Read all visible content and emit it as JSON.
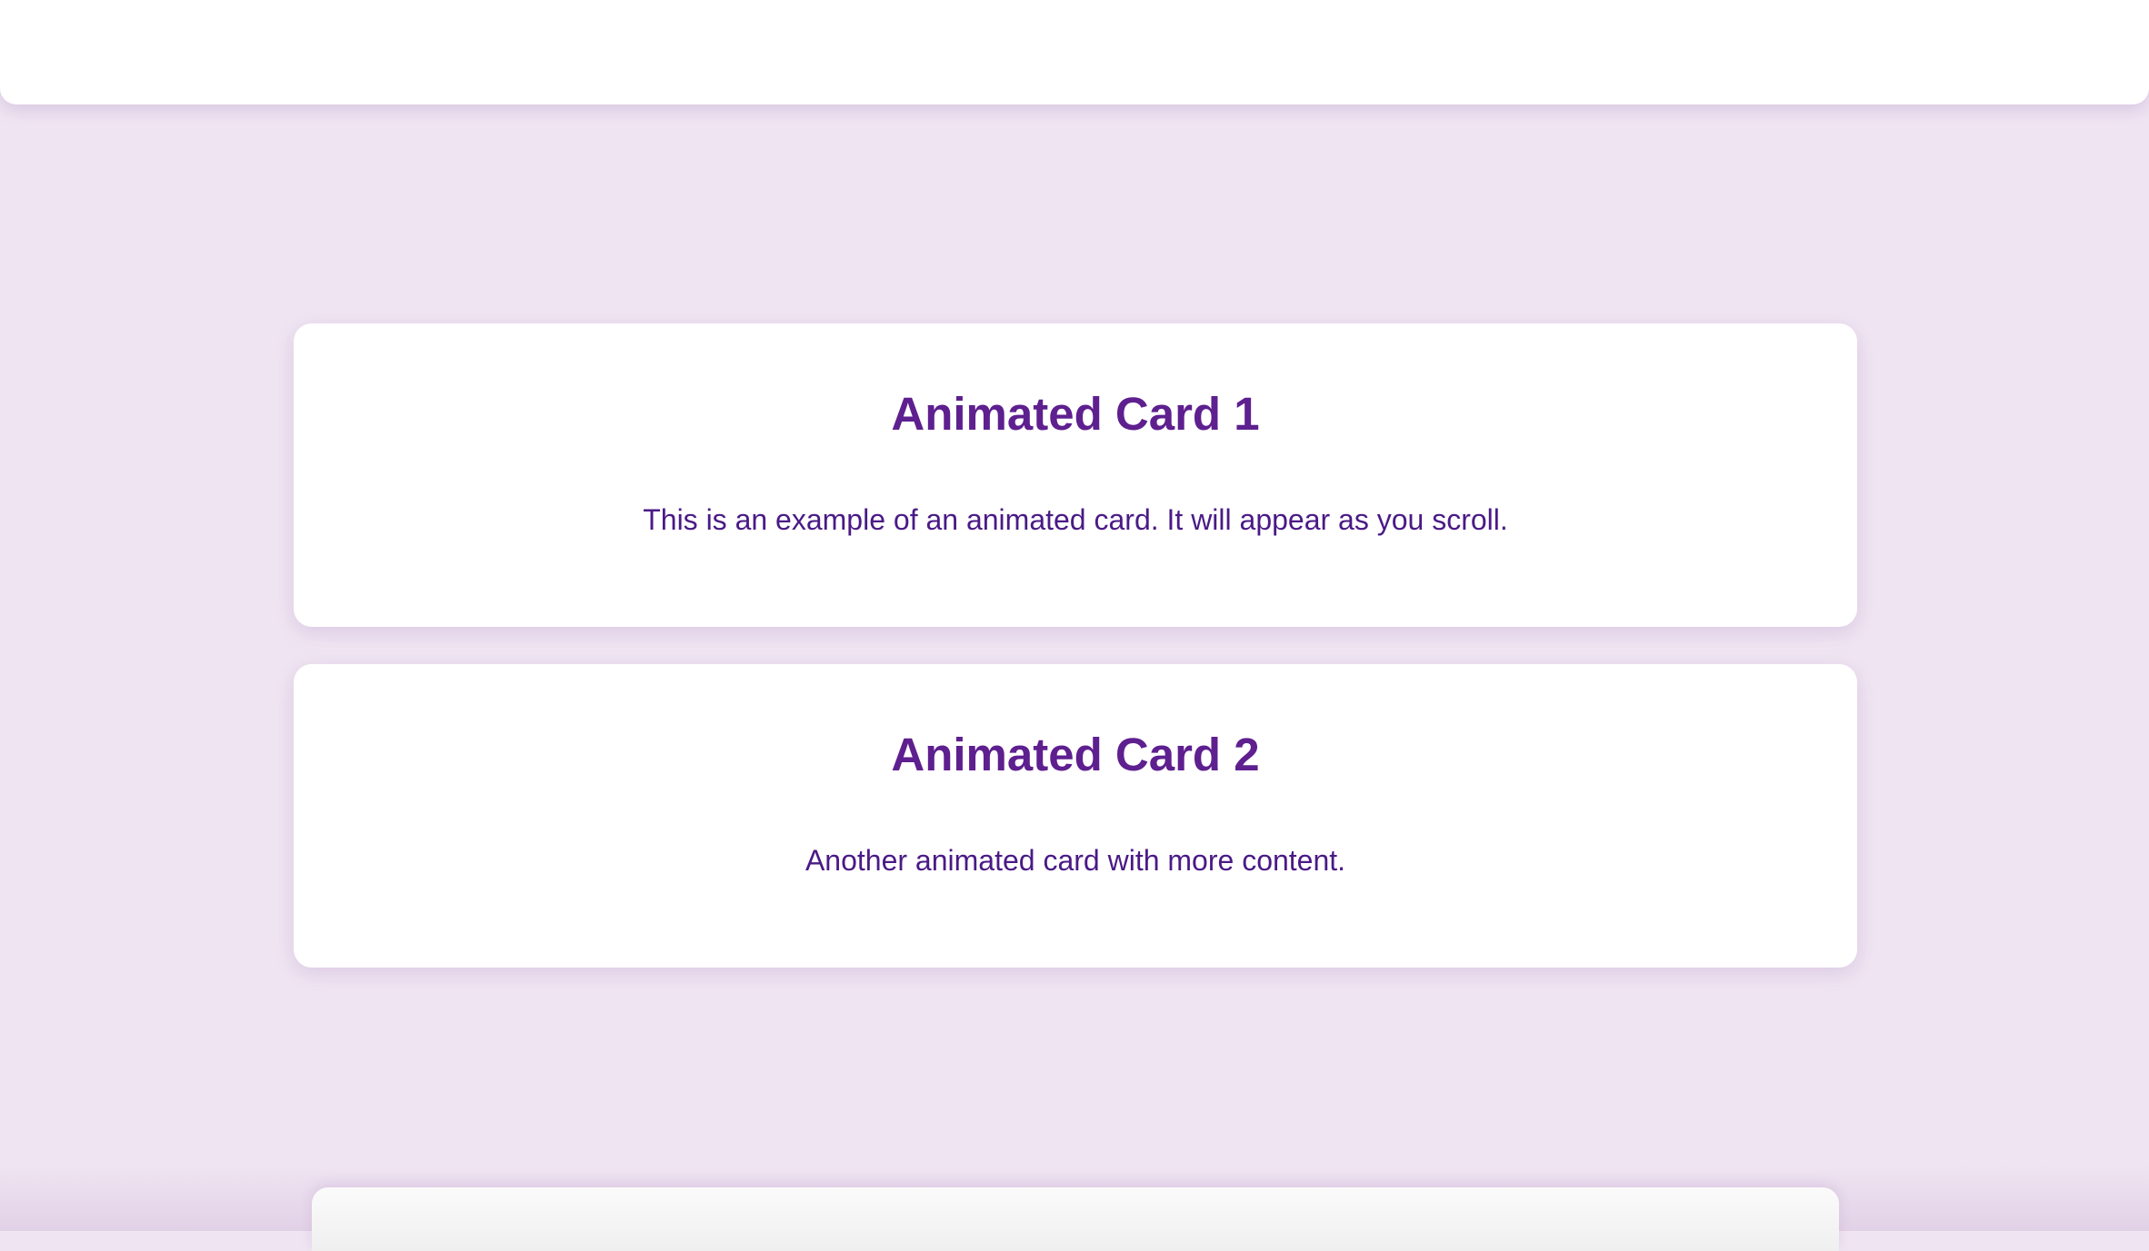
{
  "cards": [
    {
      "title": "Animated Card 1",
      "text": "This is an example of an animated card. It will appear as you scroll."
    },
    {
      "title": "Animated Card 2",
      "text": "Another animated card with more content."
    }
  ],
  "colors": {
    "background": "#efe5f2",
    "card": "#ffffff",
    "title": "#5e1f8f",
    "text": "#4a1a86"
  }
}
